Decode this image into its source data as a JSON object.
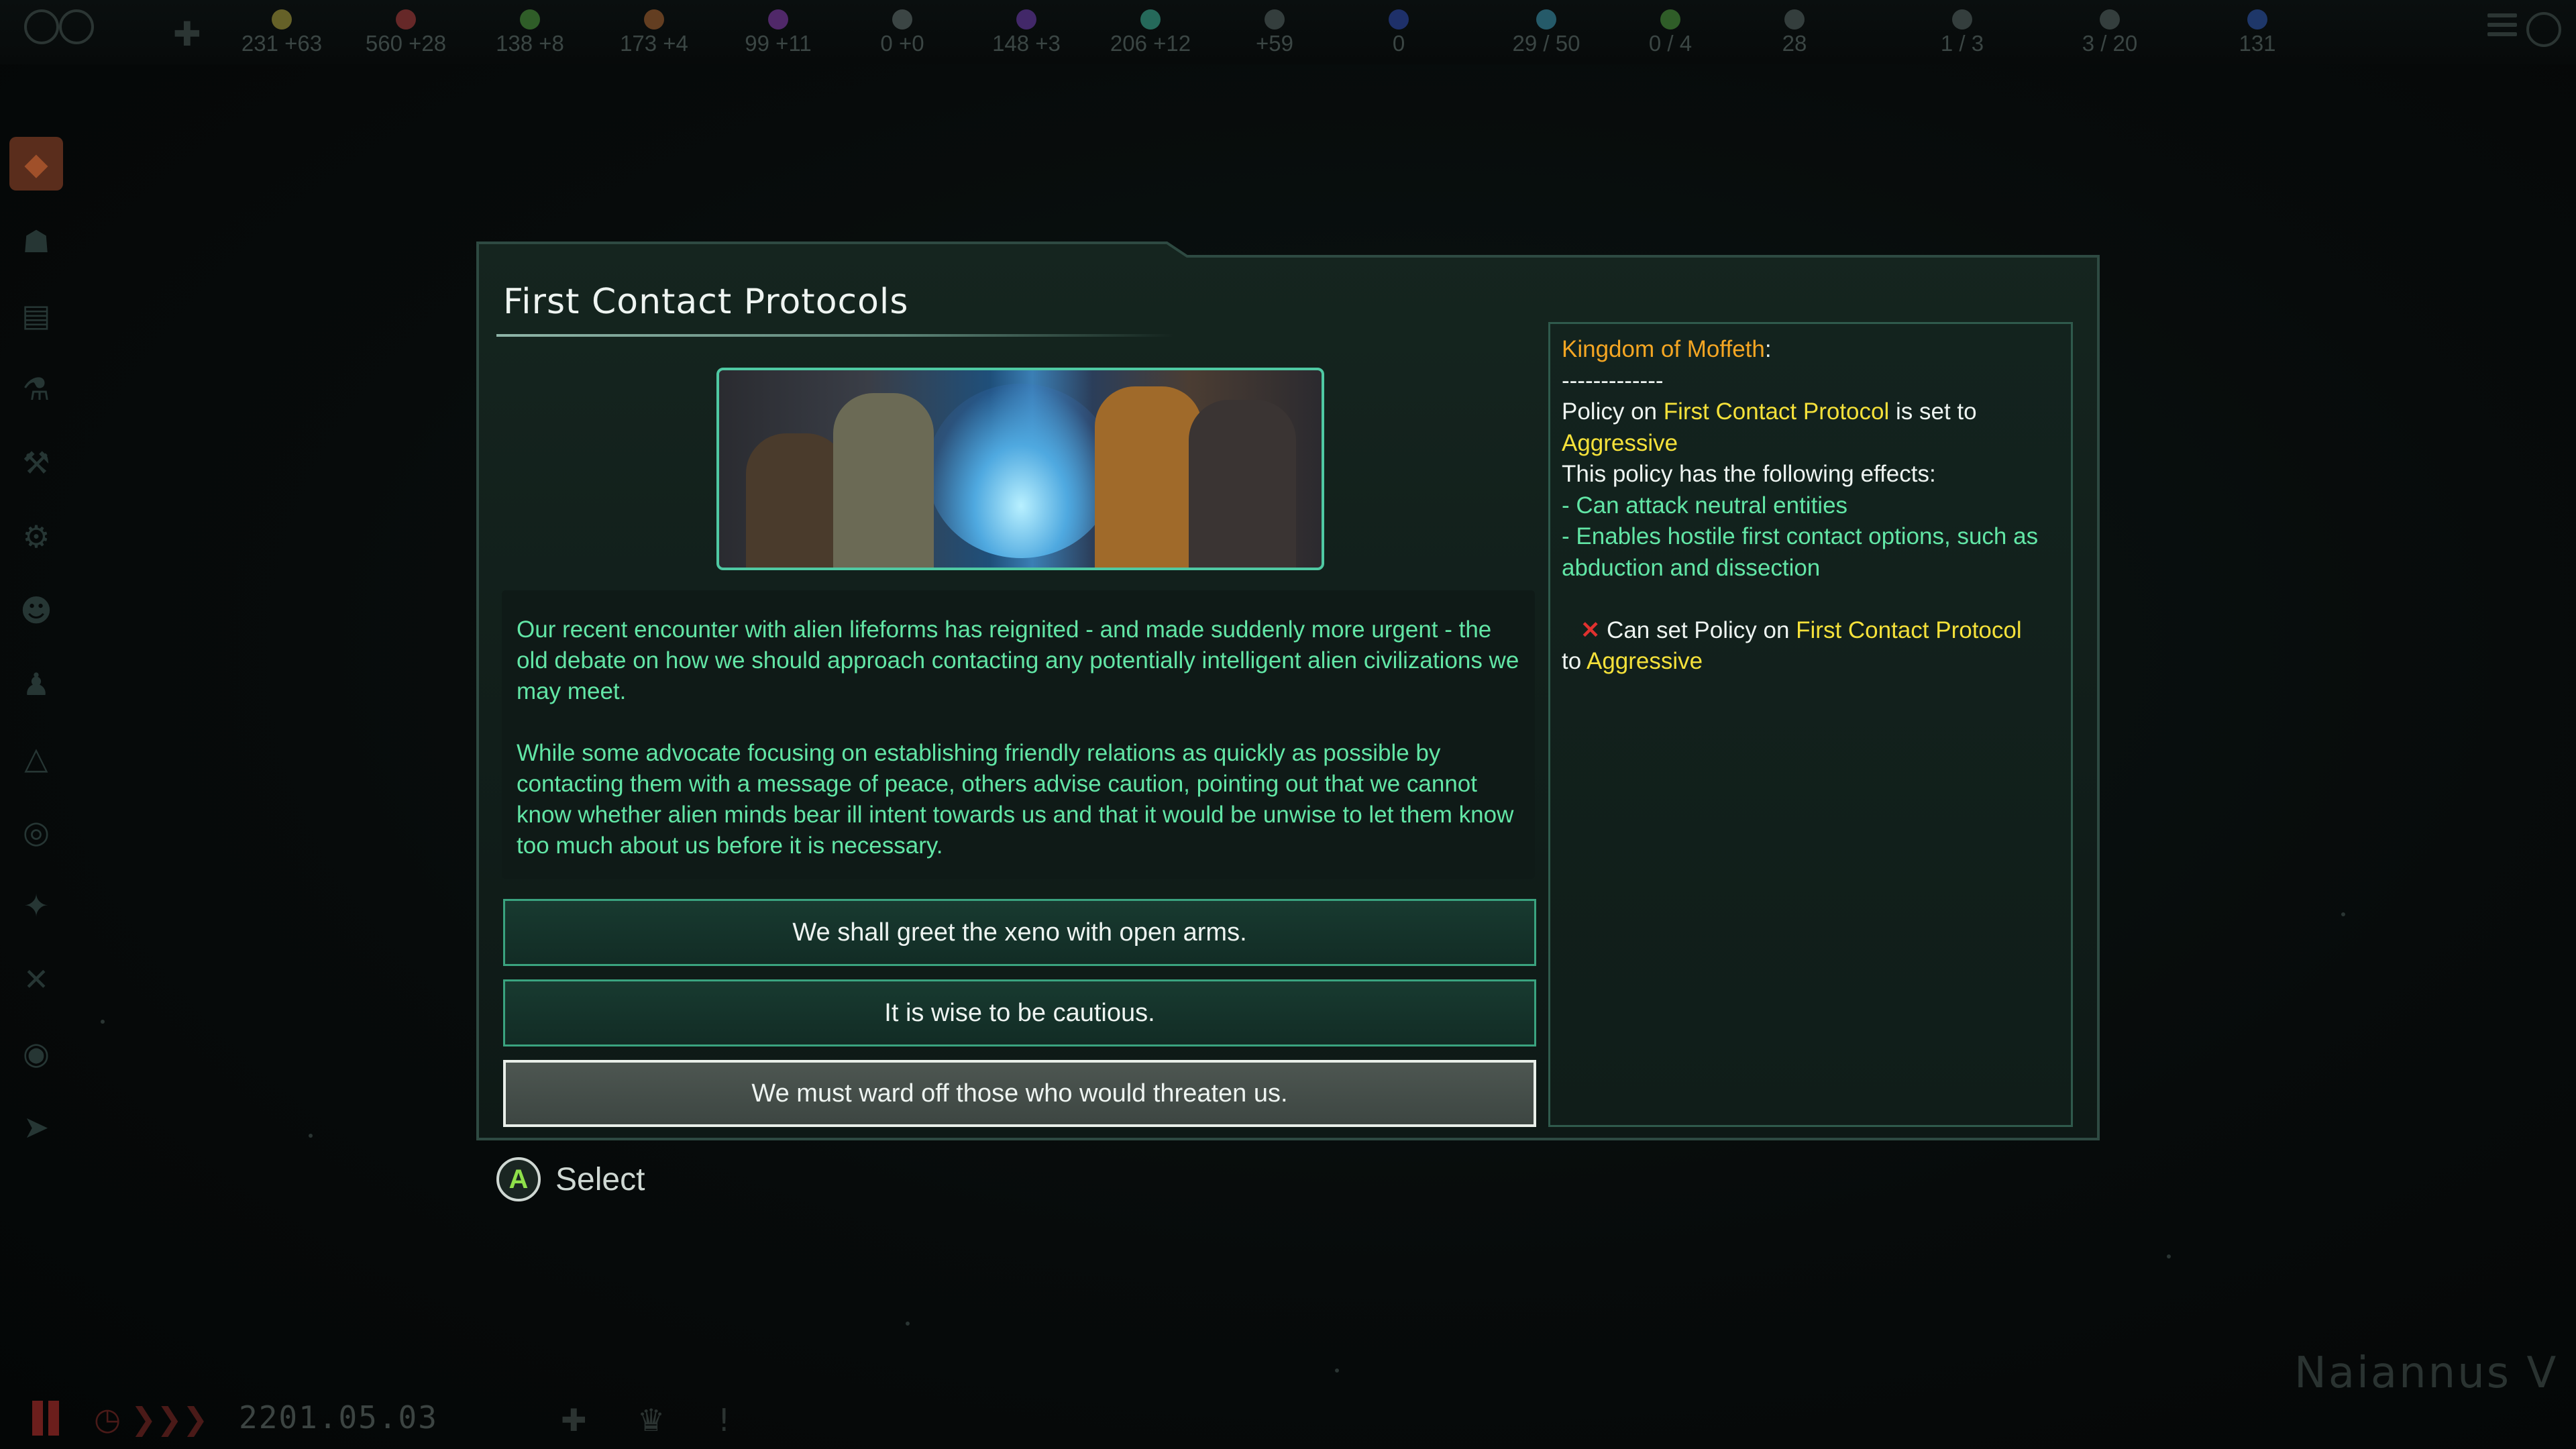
{
  "top_bar": {
    "resources": [
      {
        "name": "energy-icon",
        "value": "231 +63",
        "color": "#d6c74a"
      },
      {
        "name": "minerals-icon",
        "value": "560 +28",
        "color": "#d94a4a"
      },
      {
        "name": "food-icon",
        "value": "138 +8",
        "color": "#5fbf4a"
      },
      {
        "name": "consumer-goods-icon",
        "value": "173 +4",
        "color": "#d27a3a"
      },
      {
        "name": "alloys-icon",
        "value": "99 +11",
        "color": "#a84ad9"
      },
      {
        "name": "strategic-resource-icon",
        "value": "0 +0",
        "color": "#7a8a88"
      },
      {
        "name": "influence-icon",
        "value": "148 +3",
        "color": "#8a4ad9"
      },
      {
        "name": "unity-icon",
        "value": "206 +12",
        "color": "#4ad9b8"
      },
      {
        "name": "research-icon",
        "value": "+59",
        "color": "#6a7a78"
      },
      {
        "name": "rare-resource-icon",
        "value": "0",
        "color": "#3a5ad9"
      },
      {
        "name": "naval-capacity-icon",
        "value": "29 / 50",
        "color": "#4ab8d9"
      },
      {
        "name": "starbase-capacity-icon",
        "value": "0 / 4",
        "color": "#5fbf4a"
      },
      {
        "name": "pops-icon",
        "value": "28",
        "color": "#6a7a78"
      },
      {
        "name": "planets-icon",
        "value": "1 / 3",
        "color": "#6a7a78"
      },
      {
        "name": "systems-icon",
        "value": "3 / 20",
        "color": "#6a7a78"
      },
      {
        "name": "empire-size-icon",
        "value": "131",
        "color": "#3a6ad9"
      }
    ]
  },
  "dialog": {
    "title": "First Contact Protocols",
    "description_1": "Our recent encounter with alien lifeforms has reignited - and made suddenly more urgent - the old debate on how we should approach contacting any potentially intelligent alien civilizations we may meet.",
    "description_2": "While some advocate focusing on establishing friendly relations as quickly as possible by contacting them with a message of peace, others advise caution, pointing out that we cannot know whether alien minds bear ill intent towards us and that it would be unwise to let them know too much about us before it is necessary.",
    "options": [
      {
        "label": "We shall greet the xeno with open arms.",
        "selected": false
      },
      {
        "label": "It is wise to be cautious.",
        "selected": false
      },
      {
        "label": "We must ward off those who would threaten us.",
        "selected": true
      }
    ],
    "tooltip": {
      "empire": "Kingdom of Moffeth",
      "colon": ":",
      "separator": "-------------",
      "policy_prefix": "Policy on ",
      "policy_name": "First Contact Protocol",
      "policy_mid": " is set to",
      "policy_value": "Aggressive",
      "effects_header": "This policy has the following effects:",
      "effect_1": "- Can attack neutral entities",
      "effect_2": "- Enables hostile first contact options, such as abduction and dissection",
      "req_icon": "✕",
      "req_prefix": " Can set Policy on ",
      "req_policy": "First Contact Protocol",
      "req_to": "to ",
      "req_value": "Aggressive"
    }
  },
  "controls": {
    "a_button": "A",
    "select_label": "Select"
  },
  "bottom_bar": {
    "date": "2201.05.03",
    "planet_name": "Naiannus V"
  }
}
